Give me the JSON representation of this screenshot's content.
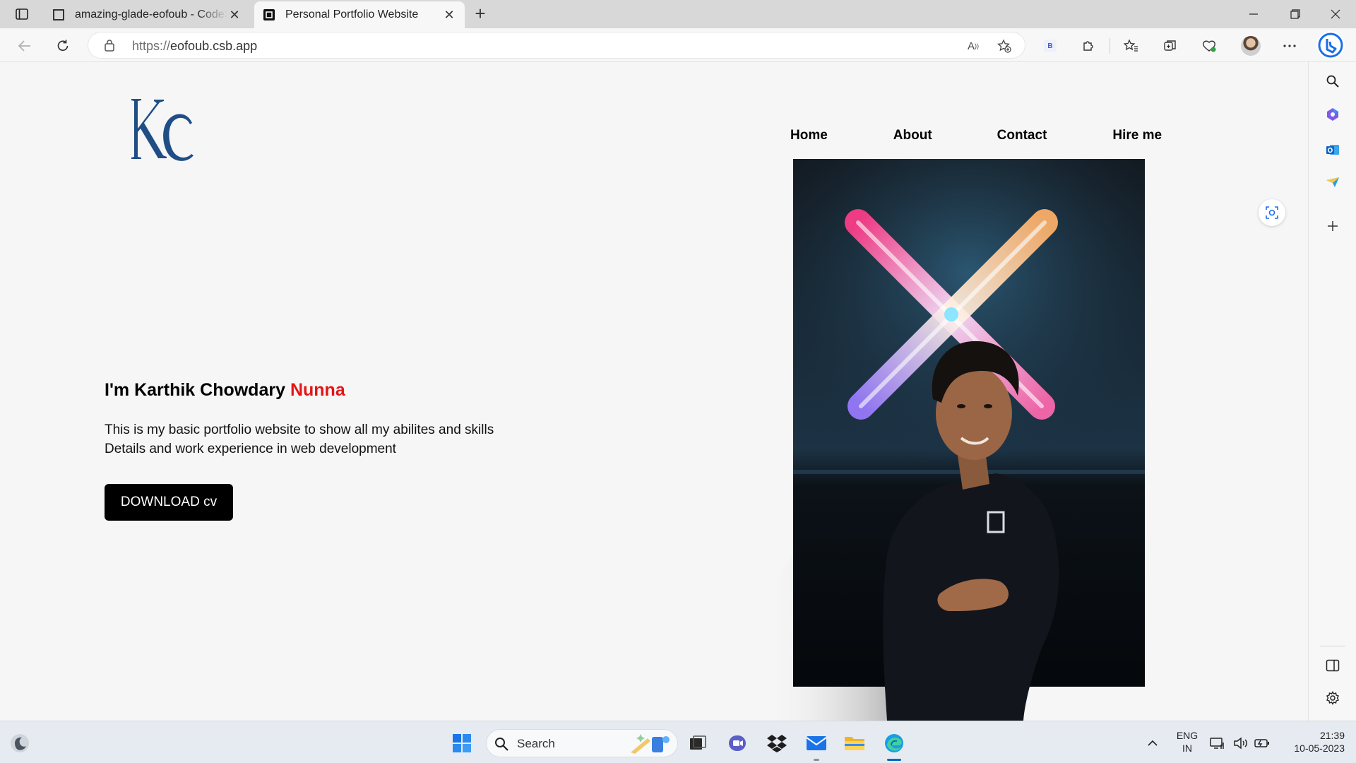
{
  "browser": {
    "tabs": [
      {
        "title": "amazing-glade-eofoub - CodeSandbox",
        "active": false
      },
      {
        "title": "Personal Portfolio Website",
        "active": true
      }
    ],
    "url_scheme": "https://",
    "url_host": "eofoub.csb.app",
    "profile_badge": "B"
  },
  "site": {
    "logo_text": "KC",
    "nav": [
      {
        "label": "Home"
      },
      {
        "label": "About"
      },
      {
        "label": "Contact"
      },
      {
        "label": "Hire me"
      }
    ],
    "hero": {
      "name_prefix": "I'm Karthik Chowdary ",
      "name_highlight": "Nunna",
      "description_line1": "This is my basic portfolio website to show all my abilites and skills",
      "description_line2": "Details and work experience in web development",
      "button_label": "DOWNLOAD cv"
    },
    "colors": {
      "accent_red": "#e41515",
      "logo_blue": "#1f4e86",
      "button_bg": "#000000"
    }
  },
  "taskbar": {
    "search_placeholder": "Search",
    "lang_line1": "ENG",
    "lang_line2": "IN",
    "time": "21:39",
    "date": "10-05-2023"
  }
}
